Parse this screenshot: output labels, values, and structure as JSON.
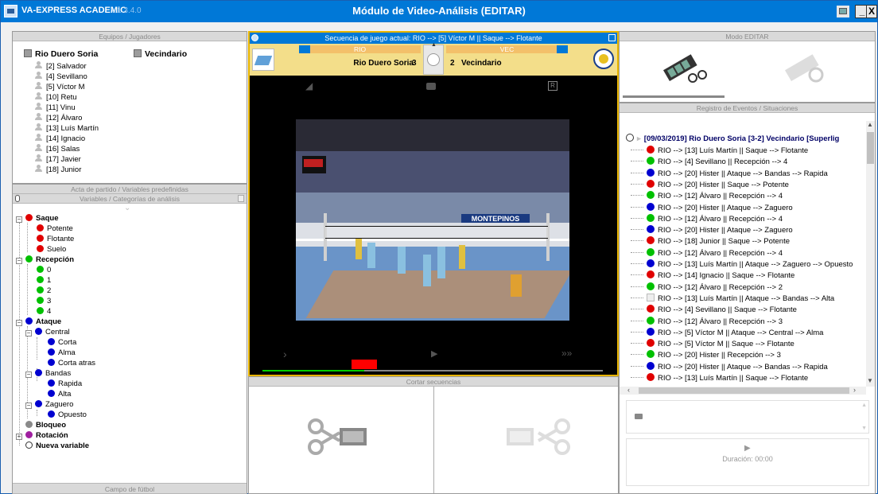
{
  "window": {
    "app_name": "VA-EXPRESS ACADEMIC",
    "version": "v.1.3.4.0",
    "title": "Módulo de Video-Análisis (EDITAR)",
    "minimize_label": "_",
    "close_label": "X"
  },
  "left": {
    "teams_header": "Equipos / Jugadores",
    "home_team": "Rio Duero Soria",
    "away_team": "Vecindario",
    "players": [
      "[2] Salvador",
      "[4] Sevillano",
      "[5] Víctor M",
      "[10] Retu",
      "[11] Vinu",
      "[12] Álvaro",
      "[13] Luís Martín",
      "[14] Ignacio",
      "[16] Salas",
      "[17] Javier",
      "[18] Junior"
    ],
    "acta_header": "Acta de partido / Variables predefinidas",
    "variables_header": "Variables / Categorías de análisis",
    "campo_footer": "Campo de fútbol"
  },
  "tree": {
    "saque": "Saque",
    "potente": "Potente",
    "flotante": "Flotante",
    "suelo": "Suelo",
    "recepcion": "Recepción",
    "r0": "0",
    "r1": "1",
    "r2": "2",
    "r3": "3",
    "r4": "4",
    "ataque": "Ataque",
    "central": "Central",
    "corta": "Corta",
    "alma": "Alma",
    "corta_atras": "Corta atras",
    "bandas": "Bandas",
    "rapida": "Rapida",
    "alta": "Alta",
    "zaguero": "Zaguero",
    "opuesto": "Opuesto",
    "bloqueo": "Bloqueo",
    "rotacion": "Rotación",
    "nueva": "Nueva variable"
  },
  "video": {
    "sequence": "Secuencia de juego actual:  RIO --> [5] Víctor M  ||  Saque --> Flotante",
    "home_abbr": "RIO",
    "away_abbr": "VEC",
    "home_name": "Rio Duero Soria",
    "home_score": "3",
    "away_score": "2",
    "away_name": "Vecindario",
    "banner_text": "MONTEPINOS",
    "progress": 0.3,
    "cut_header": "Cortar secuencias"
  },
  "right": {
    "mode_header": "Modo EDITAR",
    "log_header": "Registro de Eventos / Situaciones",
    "match_title": "[09/03/2019]  Rio Duero Soria [3-2] Vecindario  [Superlig",
    "events": [
      {
        "text": "RIO --> [13] Luís Martín  ||  Saque --> Flotante",
        "color": "#e00000"
      },
      {
        "text": "RIO --> [4] Sevillano  ||  Recepción --> 4",
        "color": "#00c000"
      },
      {
        "text": "RIO --> [20] Hister  ||  Ataque --> Bandas --> Rapida",
        "color": "#0000d0"
      },
      {
        "text": "RIO --> [20] Hister  ||  Saque --> Potente",
        "color": "#e00000"
      },
      {
        "text": "RIO --> [12] Álvaro  ||  Recepción --> 4",
        "color": "#00c000"
      },
      {
        "text": "RIO --> [20] Hister  ||  Ataque --> Zaguero",
        "color": "#0000d0"
      },
      {
        "text": "RIO --> [12] Álvaro  ||  Recepción --> 4",
        "color": "#00c000"
      },
      {
        "text": "RIO --> [20] Hister  ||  Ataque --> Zaguero",
        "color": "#0000d0"
      },
      {
        "text": "RIO --> [18] Junior  ||  Saque --> Potente",
        "color": "#e00000"
      },
      {
        "text": "RIO --> [12] Álvaro  ||  Recepción --> 4",
        "color": "#00c000"
      },
      {
        "text": "RIO --> [13] Luís Martín  ||  Ataque --> Zaguero --> Opuesto",
        "color": "#0000d0"
      },
      {
        "text": "RIO --> [14] Ignacio  ||  Saque --> Flotante",
        "color": "#e00000"
      },
      {
        "text": "RIO --> [12] Álvaro  ||  Recepción --> 2",
        "color": "#00c000"
      },
      {
        "text": "RIO --> [13] Luís Martín  ||  Ataque --> Bandas --> Alta",
        "color": "#d8d8d8"
      },
      {
        "text": "RIO --> [4] Sevillano  ||  Saque --> Flotante",
        "color": "#e00000"
      },
      {
        "text": "RIO --> [12] Álvaro  ||  Recepción --> 3",
        "color": "#00c000"
      },
      {
        "text": "RIO --> [5] Víctor M  ||  Ataque --> Central --> Alma",
        "color": "#0000d0"
      },
      {
        "text": "RIO --> [5] Víctor M  ||  Saque --> Flotante",
        "color": "#e00000"
      },
      {
        "text": "RIO --> [20] Hister  ||  Recepción --> 3",
        "color": "#00c000"
      },
      {
        "text": "RIO --> [20] Hister  ||  Ataque --> Bandas --> Rapida",
        "color": "#0000d0"
      },
      {
        "text": "RIO --> [13] Luís Martín  ||  Saque --> Flotante",
        "color": "#e00000"
      }
    ],
    "duration": "Duración: 00:00"
  },
  "colors": {
    "accent": "#0078d7",
    "video_frame": "#e8b400",
    "saque": "#e00000",
    "recepcion": "#00c000",
    "ataque": "#0000d0",
    "rotacion": "#a020a0"
  }
}
